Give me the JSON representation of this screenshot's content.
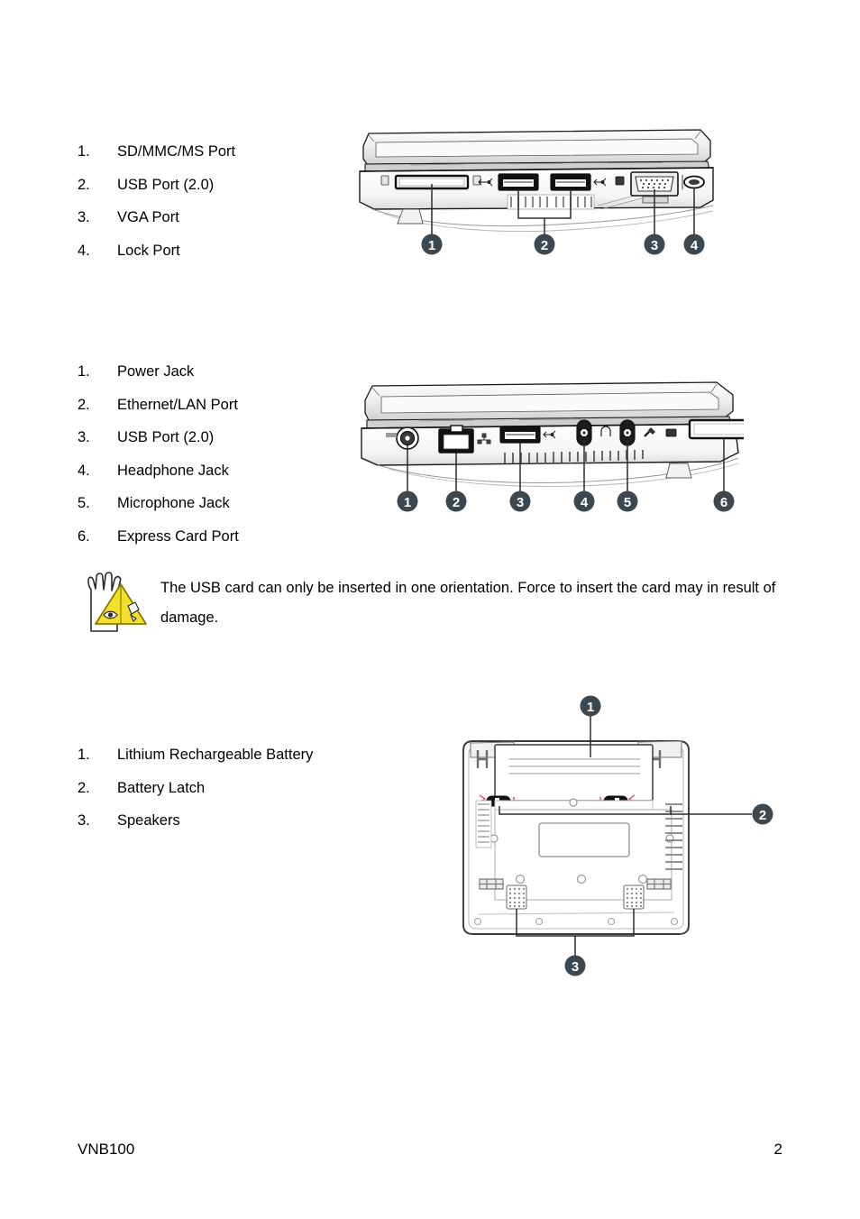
{
  "document": {
    "footer": {
      "doc_id": "VNB100",
      "page_number": "2"
    }
  },
  "sections": {
    "right_side": {
      "items": [
        {
          "num": "1.",
          "label": "SD/MMC/MS Port"
        },
        {
          "num": "2.",
          "label": "USB Port (2.0)"
        },
        {
          "num": "3.",
          "label": "VGA Port"
        },
        {
          "num": "4.",
          "label": "Lock Port"
        }
      ],
      "figure": {
        "name": "laptop-right-side-view",
        "callouts": [
          "1",
          "2",
          "3",
          "4"
        ]
      }
    },
    "left_side": {
      "items": [
        {
          "num": "1.",
          "label": "Power Jack"
        },
        {
          "num": "2.",
          "label": "Ethernet/LAN Port"
        },
        {
          "num": "3.",
          "label": "USB Port (2.0)"
        },
        {
          "num": "4.",
          "label": "Headphone Jack"
        },
        {
          "num": "5.",
          "label": "Microphone Jack"
        },
        {
          "num": "6.",
          "label": "Express Card Port"
        }
      ],
      "figure": {
        "name": "laptop-left-side-view",
        "callouts": [
          "1",
          "2",
          "3",
          "4",
          "5",
          "6"
        ]
      }
    },
    "note": {
      "icon": "hand-warning-triangle-icon",
      "text": "The USB card can only be inserted in one orientation. Force to insert the card may in result of damage."
    },
    "bottom_side": {
      "items": [
        {
          "num": "1.",
          "label": "Lithium Rechargeable Battery"
        },
        {
          "num": "2.",
          "label": "Battery Latch"
        },
        {
          "num": "3.",
          "label": "Speakers"
        }
      ],
      "figure": {
        "name": "laptop-bottom-view",
        "callouts": [
          "1",
          "2",
          "3"
        ]
      }
    }
  },
  "colors": {
    "page_background": "#ffffff",
    "text": "#000000",
    "callout_badge": "#3d4750",
    "callout_badge_text": "#ffffff",
    "line_art_stroke": "#1a1a1a",
    "line_art_fill": "#ffffff",
    "shade_light": "#e9e9e9",
    "shade_mid": "#c9c9c9",
    "shade_dark": "#4a4a4a",
    "warning_yellow": "#f2e02c",
    "warning_outline": "#8a7a00",
    "latch_accent": "#e7547f"
  }
}
